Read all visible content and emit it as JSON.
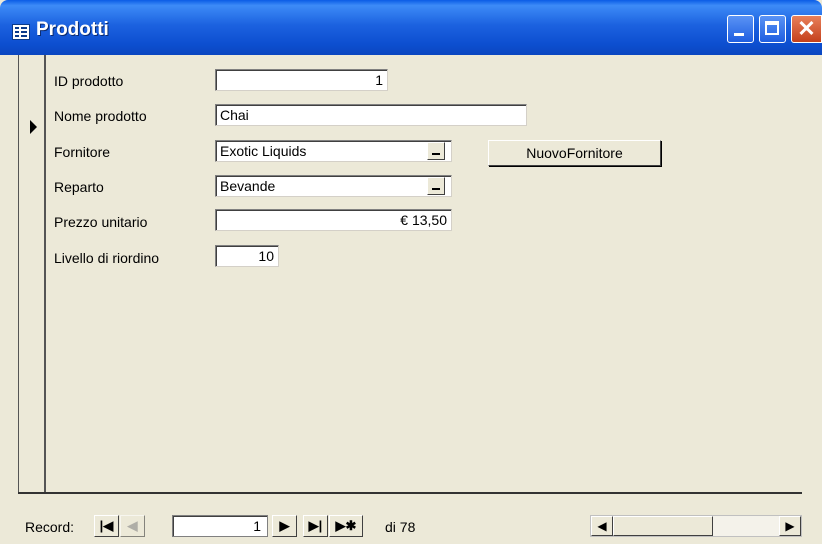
{
  "window": {
    "title": "Prodotti"
  },
  "form": {
    "fields": [
      {
        "label": "ID prodotto",
        "value": "1"
      },
      {
        "label": "Nome prodotto",
        "value": "Chai"
      },
      {
        "label": "Fornitore",
        "value": "Exotic Liquids"
      },
      {
        "label": "Reparto",
        "value": "Bevande"
      },
      {
        "label": "Prezzo unitario",
        "value": "€ 13,50"
      },
      {
        "label": "Livello di riordino",
        "value": "10"
      }
    ],
    "new_supplier_button": "NuovoFornitore"
  },
  "navigation": {
    "record_label": "Record:",
    "current_record": "1",
    "total_text": "di 78"
  }
}
